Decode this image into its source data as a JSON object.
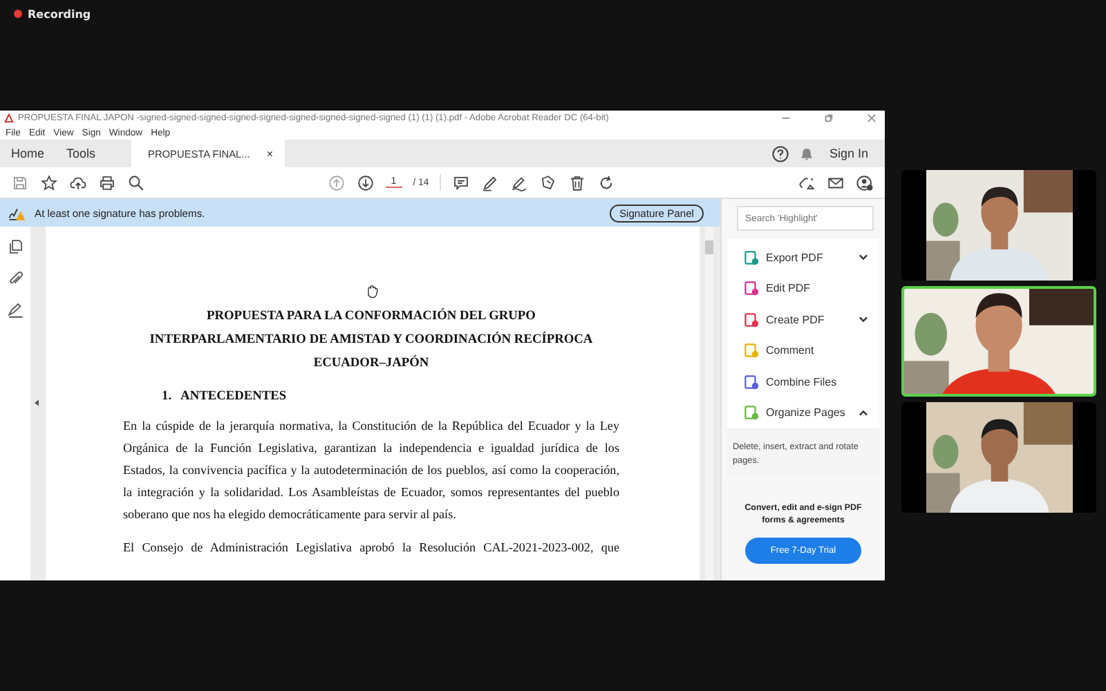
{
  "recording": {
    "label": "Recording"
  },
  "window": {
    "title": "PROPUESTA FINAL JAPON -signed-signed-signed-signed-signed-signed-signed-signed-signed (1) (1) (1).pdf - Adobe Acrobat Reader DC (64-bit)"
  },
  "menu": [
    "File",
    "Edit",
    "View",
    "Sign",
    "Window",
    "Help"
  ],
  "tabs": [
    {
      "label": "Home",
      "selected": false,
      "closable": false
    },
    {
      "label": "Tools",
      "selected": false,
      "closable": false
    },
    {
      "label": "PROPUESTA FINAL...",
      "selected": true,
      "closable": true
    }
  ],
  "close_glyph": "×",
  "sign_in": "Sign In",
  "page_nav": {
    "current": "1",
    "total": "/ 14"
  },
  "signature_bar": {
    "message": "At least one signature has problems.",
    "button": "Signature Panel"
  },
  "document": {
    "title_lines": [
      "PROPUESTA PARA LA CONFORMACIÓN DEL GRUPO",
      "INTERPARLAMENTARIO DE AMISTAD Y COORDINACIÓN RECÍPROCA",
      "ECUADOR–JAPÓN"
    ],
    "section": "1.   ANTECEDENTES",
    "paragraphs": [
      "En la cúspide de la jerarquía normativa, la Constitución de la República del Ecuador y la Ley Orgánica de la Función Legislativa, garantizan la independencia e igualdad jurídica de los Estados, la convivencia pacífica y la autodeterminación de los pueblos, así como la cooperación, la integración y la solidaridad.  Los Asambleístas de Ecuador, somos representantes del pueblo soberano que nos ha elegido democráticamente para servir al país.",
      "El Consejo de Administración Legislativa aprobó la Resolución CAL-2021-2023-002, que"
    ]
  },
  "tools_pane": {
    "search": {
      "placeholder": "Search 'Highlight'"
    },
    "tools": [
      {
        "label": "Export PDF",
        "kind": "menu",
        "expanded": false,
        "color": "#1a9a8a"
      },
      {
        "label": "Edit PDF",
        "kind": "plain",
        "color": "#d8338f"
      },
      {
        "label": "Create PDF",
        "kind": "menu",
        "expanded": false,
        "color": "#e0344a"
      },
      {
        "label": "Comment",
        "kind": "plain",
        "color": "#e8b400"
      },
      {
        "label": "Combine Files",
        "kind": "plain",
        "color": "#5b5ee0"
      },
      {
        "label": "Organize Pages",
        "kind": "menu",
        "expanded": true,
        "color": "#6ab843"
      }
    ],
    "description": "Delete, insert, extract and rotate pages.",
    "promo": "Convert, edit and e-sign PDF forms & agreements",
    "trial_button": "Free 7-Day Trial"
  },
  "video_tiles": [
    {
      "active": false
    },
    {
      "active": true
    },
    {
      "active": false
    }
  ]
}
